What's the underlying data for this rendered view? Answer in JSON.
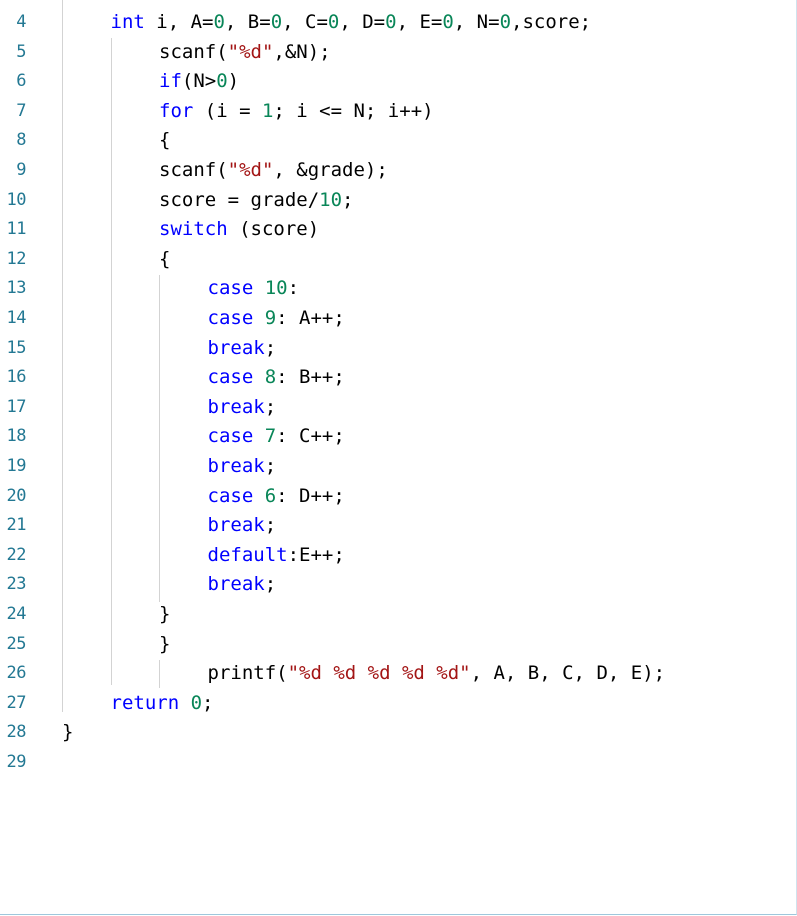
{
  "editor": {
    "lines": [
      {
        "number": "4",
        "indent": 1,
        "segments": [
          {
            "t": "int",
            "c": "kw"
          },
          {
            "t": " i, A="
          },
          {
            "t": "0",
            "c": "num"
          },
          {
            "t": ", B="
          },
          {
            "t": "0",
            "c": "num"
          },
          {
            "t": ", C="
          },
          {
            "t": "0",
            "c": "num"
          },
          {
            "t": ", D="
          },
          {
            "t": "0",
            "c": "num"
          },
          {
            "t": ", E="
          },
          {
            "t": "0",
            "c": "num"
          },
          {
            "t": ", N="
          },
          {
            "t": "0",
            "c": "num"
          },
          {
            "t": ",score;"
          }
        ]
      },
      {
        "number": "5",
        "indent": 2,
        "segments": [
          {
            "t": "scanf("
          },
          {
            "t": "\"%d\"",
            "c": "str"
          },
          {
            "t": ",&N);"
          }
        ]
      },
      {
        "number": "6",
        "indent": 2,
        "segments": [
          {
            "t": "if",
            "c": "kw"
          },
          {
            "t": "(N>"
          },
          {
            "t": "0",
            "c": "num"
          },
          {
            "t": ")"
          }
        ]
      },
      {
        "number": "7",
        "indent": 2,
        "segments": [
          {
            "t": "for",
            "c": "kw"
          },
          {
            "t": " (i = "
          },
          {
            "t": "1",
            "c": "num"
          },
          {
            "t": "; i <= N; i++)"
          }
        ]
      },
      {
        "number": "8",
        "indent": 2,
        "segments": [
          {
            "t": "{"
          }
        ]
      },
      {
        "number": "9",
        "indent": 2,
        "segments": [
          {
            "t": "scanf("
          },
          {
            "t": "\"%d\"",
            "c": "str"
          },
          {
            "t": ", &grade);"
          }
        ]
      },
      {
        "number": "10",
        "indent": 2,
        "segments": [
          {
            "t": "score = grade/"
          },
          {
            "t": "10",
            "c": "num"
          },
          {
            "t": ";"
          }
        ]
      },
      {
        "number": "11",
        "indent": 2,
        "segments": [
          {
            "t": "switch",
            "c": "kw"
          },
          {
            "t": " (score)"
          }
        ]
      },
      {
        "number": "12",
        "indent": 2,
        "segments": [
          {
            "t": "{"
          }
        ]
      },
      {
        "number": "13",
        "indent": 3,
        "segments": [
          {
            "t": "case",
            "c": "kw"
          },
          {
            "t": " "
          },
          {
            "t": "10",
            "c": "num"
          },
          {
            "t": ":"
          }
        ]
      },
      {
        "number": "14",
        "indent": 3,
        "segments": [
          {
            "t": "case",
            "c": "kw"
          },
          {
            "t": " "
          },
          {
            "t": "9",
            "c": "num"
          },
          {
            "t": ": A++;"
          }
        ]
      },
      {
        "number": "15",
        "indent": 3,
        "segments": [
          {
            "t": "break",
            "c": "kw"
          },
          {
            "t": ";"
          }
        ]
      },
      {
        "number": "16",
        "indent": 3,
        "segments": [
          {
            "t": "case",
            "c": "kw"
          },
          {
            "t": " "
          },
          {
            "t": "8",
            "c": "num"
          },
          {
            "t": ": B++;"
          }
        ]
      },
      {
        "number": "17",
        "indent": 3,
        "segments": [
          {
            "t": "break",
            "c": "kw"
          },
          {
            "t": ";"
          }
        ]
      },
      {
        "number": "18",
        "indent": 3,
        "segments": [
          {
            "t": "case",
            "c": "kw"
          },
          {
            "t": " "
          },
          {
            "t": "7",
            "c": "num"
          },
          {
            "t": ": C++;"
          }
        ]
      },
      {
        "number": "19",
        "indent": 3,
        "segments": [
          {
            "t": "break",
            "c": "kw"
          },
          {
            "t": ";"
          }
        ]
      },
      {
        "number": "20",
        "indent": 3,
        "segments": [
          {
            "t": "case",
            "c": "kw"
          },
          {
            "t": " "
          },
          {
            "t": "6",
            "c": "num"
          },
          {
            "t": ": D++;"
          }
        ]
      },
      {
        "number": "21",
        "indent": 3,
        "segments": [
          {
            "t": "break",
            "c": "kw"
          },
          {
            "t": ";"
          }
        ]
      },
      {
        "number": "22",
        "indent": 3,
        "segments": [
          {
            "t": "default",
            "c": "kw"
          },
          {
            "t": ":E++;"
          }
        ]
      },
      {
        "number": "23",
        "indent": 3,
        "segments": [
          {
            "t": "break",
            "c": "kw"
          },
          {
            "t": ";"
          }
        ]
      },
      {
        "number": "24",
        "indent": 2,
        "segments": [
          {
            "t": "}"
          }
        ]
      },
      {
        "number": "25",
        "indent": 2,
        "segments": [
          {
            "t": "}"
          }
        ]
      },
      {
        "number": "26",
        "indent": 3,
        "segments": [
          {
            "t": "printf("
          },
          {
            "t": "\"%d %d %d %d %d\"",
            "c": "str"
          },
          {
            "t": ", A, B, C, D, E);"
          }
        ]
      },
      {
        "number": "27",
        "indent": 1,
        "segments": [
          {
            "t": "return",
            "c": "kw"
          },
          {
            "t": " "
          },
          {
            "t": "0",
            "c": "num"
          },
          {
            "t": ";"
          }
        ]
      },
      {
        "number": "28",
        "indent": 0,
        "segments": [
          {
            "t": "}"
          }
        ]
      },
      {
        "number": "29",
        "indent": 0,
        "segments": []
      }
    ]
  },
  "colors": {
    "keyword": "#0000ff",
    "string": "#a31515",
    "number": "#098658",
    "line_number": "#237893",
    "text": "#000000"
  }
}
